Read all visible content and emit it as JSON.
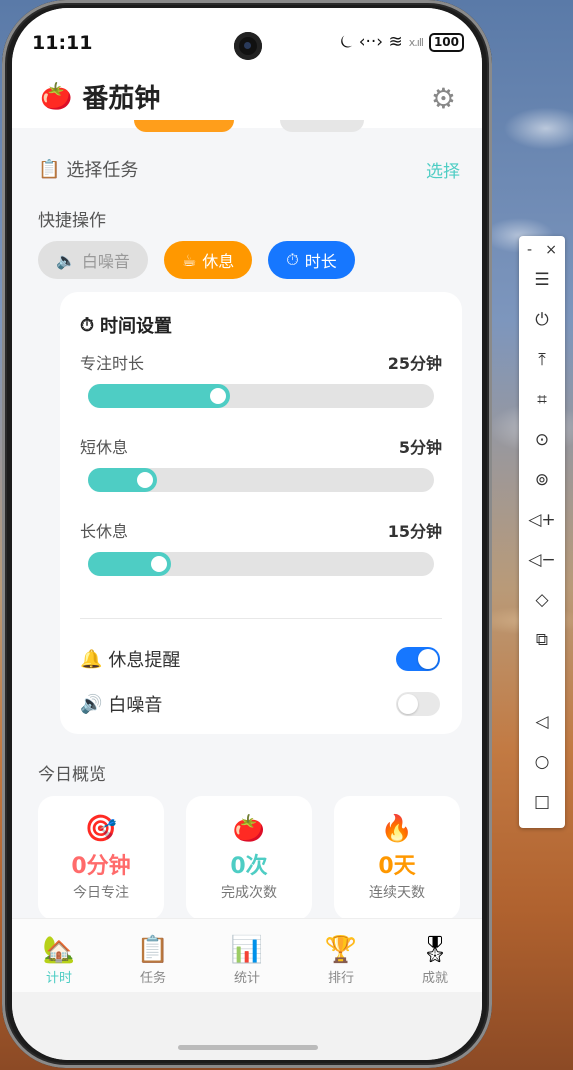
{
  "status_bar": {
    "time": "11:11",
    "icons": "⏾ ‹··› ≋ ",
    "signal": "x.ıll",
    "battery": "100"
  },
  "header": {
    "emoji": "🍅",
    "title": "番茄钟",
    "settings_icon": "⚙"
  },
  "task": {
    "icon": "📋",
    "label": "选择任务",
    "action": "选择"
  },
  "quick_actions": {
    "title": "快捷操作",
    "chips": [
      {
        "icon": "🔈",
        "label": "白噪音"
      },
      {
        "icon": "☕",
        "label": "休息"
      },
      {
        "icon": "⏱",
        "label": "时长"
      }
    ]
  },
  "time_settings": {
    "icon": "⏱",
    "title": "时间设置",
    "items": [
      {
        "label": "专注时长",
        "value": "25分钟",
        "level": 0.41
      },
      {
        "label": "短休息",
        "value": "5分钟",
        "level": 0.2
      },
      {
        "label": "长休息",
        "value": "15分钟",
        "level": 0.24
      }
    ],
    "toggles": [
      {
        "icon": "🔔",
        "label": "休息提醒",
        "on": true
      },
      {
        "icon": "🔊",
        "label": "白噪音",
        "on": false
      }
    ]
  },
  "overview": {
    "title": "今日概览",
    "stats": [
      {
        "icon": "🎯",
        "value": "0分钟",
        "caption": "今日专注",
        "color": "#ff6b6b"
      },
      {
        "icon": "🍅",
        "value": "0次",
        "caption": "完成次数",
        "color": "#4ecdc4"
      },
      {
        "icon": "🔥",
        "value": "0天",
        "caption": "连续天数",
        "color": "#ff9800"
      }
    ]
  },
  "tabs": [
    {
      "icon": "🏡",
      "label": "计时",
      "active": true
    },
    {
      "icon": "📋",
      "label": "任务",
      "active": false
    },
    {
      "icon": "📊",
      "label": "统计",
      "active": false
    },
    {
      "icon": "🏆",
      "label": "排行",
      "active": false
    },
    {
      "icon": "🎖",
      "label": "成就",
      "active": false
    }
  ],
  "side_toolbar": {
    "minimize": "-",
    "close": "×",
    "items": [
      "menu-icon",
      "power-icon",
      "pin-top-icon",
      "crop-icon",
      "rotate-icon",
      "rotate-alt-icon",
      "volume-up-icon",
      "volume-down-icon",
      "shake-icon",
      "copy-icon",
      "back-icon",
      "home-icon",
      "recents-icon"
    ],
    "glyphs": [
      "☰",
      "⏻",
      "⤒",
      "⌗",
      "⊙",
      "⊚",
      "◁+",
      "◁−",
      "◇",
      "⧉",
      "◁",
      "○",
      "□"
    ]
  },
  "colors": {
    "teal": "#4ecdc4",
    "blue": "#1677ff",
    "orange": "#ff9800"
  }
}
